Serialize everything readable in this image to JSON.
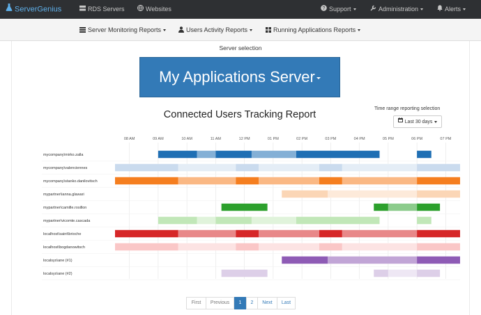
{
  "navbar": {
    "brand": "ServerGenius",
    "rds_servers": "RDS Servers",
    "websites": "Websites",
    "support": "Support",
    "administration": "Administration",
    "alerts": "Alerts"
  },
  "subnav": {
    "server_monitoring": "Server Monitoring Reports",
    "users_activity": "Users Activity Reports",
    "running_apps": "Running Applications Reports"
  },
  "server_selection": {
    "label": "Server selection",
    "selected": "My Applications Server"
  },
  "report_title": "Connected Users Tracking Report",
  "time_range": {
    "label": "Time range reporting selection",
    "selected": "Last 30 days"
  },
  "pagination": {
    "first": "First",
    "previous": "Previous",
    "pages": [
      "1",
      "2"
    ],
    "current": "1",
    "next": "Next",
    "last": "Last"
  },
  "colors": {
    "navbar_bg": "#2e3033",
    "brand": "#5fb0ea",
    "primary": "#337ab7"
  },
  "chart_data": {
    "type": "timeline",
    "x_ticks": [
      "08 AM",
      "09 AM",
      "10 AM",
      "11 AM",
      "12 PM",
      "01 PM",
      "02 PM",
      "03 PM",
      "04 PM",
      "05 PM",
      "06 PM",
      "07 PM"
    ],
    "x_range": [
      7.5,
      19.5
    ],
    "rows": [
      {
        "label": "mycompany\\mirko.zalla",
        "color": "#1f6fb4",
        "segments": [
          [
            9.0,
            10.35,
            "dark"
          ],
          [
            10.35,
            11.0,
            "mid"
          ],
          [
            11.0,
            12.25,
            "dark"
          ],
          [
            12.25,
            13.8,
            "mid"
          ],
          [
            13.8,
            16.7,
            "dark"
          ],
          [
            18.0,
            18.5,
            "dark"
          ]
        ]
      },
      {
        "label": "mycompany\\valenciennes",
        "color": "#9ebde0",
        "segments": [
          [
            7.5,
            9.7,
            "mid"
          ],
          [
            9.7,
            11.7,
            "light"
          ],
          [
            11.7,
            12.5,
            "mid"
          ],
          [
            12.5,
            14.6,
            "light"
          ],
          [
            14.6,
            15.4,
            "mid"
          ],
          [
            15.4,
            18.0,
            "light"
          ],
          [
            18.0,
            19.5,
            "mid"
          ]
        ]
      },
      {
        "label": "mycompany\\stanko.danilovitsch",
        "color": "#f57e1f",
        "segments": [
          [
            7.5,
            9.7,
            "dark"
          ],
          [
            9.7,
            11.7,
            "mid"
          ],
          [
            11.7,
            12.5,
            "dark"
          ],
          [
            12.5,
            14.6,
            "mid"
          ],
          [
            14.6,
            15.4,
            "dark"
          ],
          [
            15.4,
            18.0,
            "mid"
          ],
          [
            18.0,
            19.5,
            "dark"
          ]
        ]
      },
      {
        "label": "mypartner\\ianna.glawari",
        "color": "#f8b57a",
        "segments": [
          [
            13.3,
            14.9,
            "mid"
          ],
          [
            14.9,
            18.0,
            "light"
          ],
          [
            18.0,
            19.5,
            "mid"
          ]
        ]
      },
      {
        "label": "mypartner\\camille.rosillon",
        "color": "#2ca02c",
        "segments": [
          [
            11.2,
            12.8,
            "dark"
          ],
          [
            16.5,
            17.0,
            "dark"
          ],
          [
            17.0,
            18.0,
            "mid"
          ],
          [
            18.0,
            18.8,
            "dark"
          ]
        ]
      },
      {
        "label": "mypartner\\vicomte.cascada",
        "color": "#8fd47d",
        "segments": [
          [
            9.0,
            10.35,
            "mid"
          ],
          [
            10.35,
            11.0,
            "light"
          ],
          [
            11.0,
            12.25,
            "mid"
          ],
          [
            12.25,
            13.8,
            "light"
          ],
          [
            13.8,
            16.7,
            "mid"
          ],
          [
            18.0,
            18.5,
            "mid"
          ]
        ]
      },
      {
        "label": "localhost\\saint\\brioche",
        "color": "#d62728",
        "segments": [
          [
            7.5,
            9.7,
            "dark"
          ],
          [
            9.7,
            11.7,
            "mid"
          ],
          [
            11.7,
            12.5,
            "dark"
          ],
          [
            12.5,
            14.6,
            "mid"
          ],
          [
            14.6,
            15.4,
            "dark"
          ],
          [
            15.4,
            18.0,
            "mid"
          ],
          [
            18.0,
            19.5,
            "dark"
          ]
        ]
      },
      {
        "label": "localhost\\bogdanowitsch",
        "color": "#f59a9a",
        "segments": [
          [
            7.5,
            9.7,
            "mid"
          ],
          [
            9.7,
            11.7,
            "light"
          ],
          [
            11.7,
            12.5,
            "mid"
          ],
          [
            12.5,
            14.6,
            "light"
          ],
          [
            14.6,
            15.4,
            "mid"
          ],
          [
            15.4,
            18.0,
            "light"
          ],
          [
            18.0,
            19.5,
            "mid"
          ]
        ]
      },
      {
        "label": "localsys\\ane (#1)",
        "color": "#8e5bb5",
        "segments": [
          [
            13.3,
            14.9,
            "dark"
          ],
          [
            14.9,
            18.0,
            "mid"
          ],
          [
            18.0,
            19.5,
            "dark"
          ]
        ]
      },
      {
        "label": "localsys\\ane (#2)",
        "color": "#c2a8d6",
        "segments": [
          [
            11.2,
            12.8,
            "mid"
          ],
          [
            16.5,
            17.0,
            "mid"
          ],
          [
            17.0,
            18.0,
            "light"
          ],
          [
            18.0,
            18.8,
            "mid"
          ]
        ]
      }
    ]
  }
}
